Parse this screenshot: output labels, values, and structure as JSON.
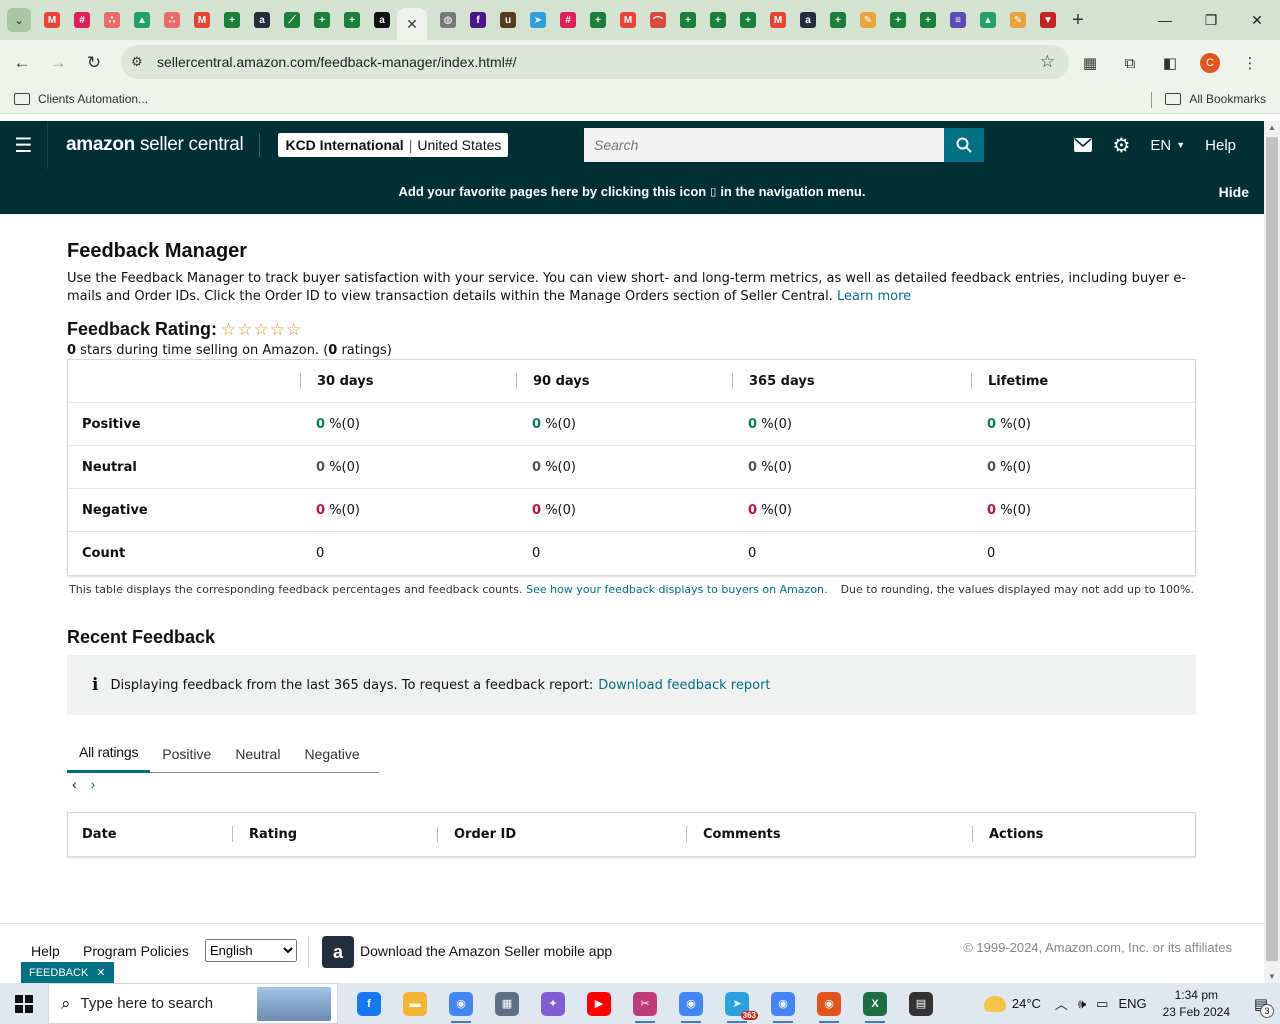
{
  "browser": {
    "tab_favicons": [
      {
        "name": "gmail-icon",
        "color": "#ea4335",
        "glyph": "M"
      },
      {
        "name": "slack-icon",
        "color": "#e01e5a",
        "glyph": "#"
      },
      {
        "name": "asana-icon",
        "color": "#f06a6a",
        "glyph": "∴"
      },
      {
        "name": "drive-icon",
        "color": "#1fa463",
        "glyph": "▲"
      },
      {
        "name": "asana-icon",
        "color": "#f06a6a",
        "glyph": "∴"
      },
      {
        "name": "gmail-icon",
        "color": "#ea4335",
        "glyph": "M"
      },
      {
        "name": "sheets-icon",
        "color": "#188038",
        "glyph": "+"
      },
      {
        "name": "amazon-icon",
        "color": "#232f3e",
        "glyph": "a"
      },
      {
        "name": "script-icon",
        "color": "#188038",
        "glyph": "⟋"
      },
      {
        "name": "sheets-icon",
        "color": "#188038",
        "glyph": "+"
      },
      {
        "name": "sheets-icon",
        "color": "#188038",
        "glyph": "+"
      },
      {
        "name": "amazon-icon",
        "color": "#111111",
        "glyph": "a"
      }
    ],
    "tab_favicons_after": [
      {
        "name": "globe-icon",
        "color": "#777777",
        "glyph": "◍"
      },
      {
        "name": "fedex-icon",
        "color": "#4d148c",
        "glyph": "f"
      },
      {
        "name": "ups-icon",
        "color": "#5a3b1c",
        "glyph": "u"
      },
      {
        "name": "telegram-icon",
        "color": "#2aa1de",
        "glyph": "➤"
      },
      {
        "name": "slack-icon",
        "color": "#e01e5a",
        "glyph": "#"
      },
      {
        "name": "sheets-icon",
        "color": "#188038",
        "glyph": "+"
      },
      {
        "name": "gmail-icon",
        "color": "#ea4335",
        "glyph": "M"
      },
      {
        "name": "rainbow-icon",
        "color": "#d84a3a",
        "glyph": "⌒"
      },
      {
        "name": "sheets-icon",
        "color": "#188038",
        "glyph": "+"
      },
      {
        "name": "sheets-icon",
        "color": "#188038",
        "glyph": "+"
      },
      {
        "name": "sheets-icon",
        "color": "#188038",
        "glyph": "+"
      },
      {
        "name": "gmail-icon",
        "color": "#ea4335",
        "glyph": "M"
      },
      {
        "name": "amazon-icon",
        "color": "#232f3e",
        "glyph": "a"
      },
      {
        "name": "sheets-icon",
        "color": "#188038",
        "glyph": "+"
      },
      {
        "name": "pen-icon",
        "color": "#e8a33d",
        "glyph": "✎"
      },
      {
        "name": "sheets-icon",
        "color": "#188038",
        "glyph": "+"
      },
      {
        "name": "sheets-icon",
        "color": "#188038",
        "glyph": "+"
      },
      {
        "name": "list-icon",
        "color": "#5b4bb7",
        "glyph": "≡"
      },
      {
        "name": "drive-icon",
        "color": "#1fa463",
        "glyph": "▲"
      },
      {
        "name": "pen-icon",
        "color": "#e8a33d",
        "glyph": "✎"
      },
      {
        "name": "flag-icon",
        "color": "#c5221f",
        "glyph": "▼"
      }
    ],
    "url": "sellercentral.amazon.com/feedback-manager/index.html#/",
    "bookmarks": {
      "left": "Clients Automation...",
      "right": "All Bookmarks"
    },
    "profile_initial": "C"
  },
  "header": {
    "logo_bold": "amazon",
    "logo_light": "seller central",
    "account_name": "KCD International",
    "account_region": "United States",
    "search_placeholder": "Search",
    "language": "EN",
    "help": "Help",
    "fav_message_pre": "Add your favorite pages here by clicking this icon",
    "fav_message_post": "in the navigation menu.",
    "hide": "Hide"
  },
  "page": {
    "title": "Feedback Manager",
    "intro": "Use the Feedback Manager to track buyer satisfaction with your service. You can view short- and long-term metrics, as well as detailed feedback entries, including buyer e-mails and Order IDs. Click the Order ID to view transaction details within the Manage Orders section of Seller Central.",
    "learn_more": "Learn more",
    "rating_label": "Feedback Rating:",
    "rating_stars": 0,
    "rating_stars_max": 5,
    "rating_sub_stars": "0",
    "rating_sub_mid": " stars during time selling on Amazon. (",
    "rating_sub_count": "0",
    "rating_sub_end": " ratings)"
  },
  "metrics": {
    "columns": [
      "30 days",
      "90 days",
      "365 days",
      "Lifetime"
    ],
    "rows": [
      {
        "label": "Positive",
        "cells": [
          {
            "n": "0",
            "p": "%(0)"
          },
          {
            "n": "0",
            "p": "%(0)"
          },
          {
            "n": "0",
            "p": "%(0)"
          },
          {
            "n": "0",
            "p": "%(0)"
          }
        ]
      },
      {
        "label": "Neutral",
        "cells": [
          {
            "n": "0",
            "p": "%(0)"
          },
          {
            "n": "0",
            "p": "%(0)"
          },
          {
            "n": "0",
            "p": "%(0)"
          },
          {
            "n": "0",
            "p": "%(0)"
          }
        ]
      },
      {
        "label": "Negative",
        "cells": [
          {
            "n": "0",
            "p": "%(0)"
          },
          {
            "n": "0",
            "p": "%(0)"
          },
          {
            "n": "0",
            "p": "%(0)"
          },
          {
            "n": "0",
            "p": "%(0)"
          }
        ]
      },
      {
        "label": "Count",
        "cells": [
          "0",
          "0",
          "0",
          "0"
        ]
      }
    ],
    "note_left": "This table displays the corresponding feedback percentages and feedback counts.",
    "note_link": "See how your feedback displays to buyers on Amazon.",
    "note_right": "Due to rounding, the values displayed may not add up to 100%.",
    "colors": {
      "positive": "#067d62",
      "negative": "#cc0c39"
    }
  },
  "recent": {
    "title": "Recent Feedback",
    "info_text": "Displaying feedback from the last 365 days. To request a feedback report:",
    "info_link": "Download feedback report",
    "tabs": [
      "All ratings",
      "Positive",
      "Neutral",
      "Negative"
    ],
    "table_columns": [
      "Date",
      "Rating",
      "Order ID",
      "Comments",
      "Actions"
    ]
  },
  "footer": {
    "help": "Help",
    "policies": "Program Policies",
    "language_selected": "English",
    "app_text": "Download the Amazon Seller mobile app",
    "copyright": "© 1999-2024, Amazon.com, Inc. or its affiliates",
    "badge": "FEEDBACK"
  },
  "taskbar": {
    "search_placeholder": "Type here to search",
    "apps": [
      {
        "name": "facebook-icon",
        "color": "#1877f2",
        "glyph": "f",
        "running": false
      },
      {
        "name": "file-explorer-icon",
        "color": "#f2b632",
        "glyph": "▬",
        "running": false
      },
      {
        "name": "chrome-icon",
        "color": "#4285f4",
        "glyph": "◉",
        "running": true
      },
      {
        "name": "calculator-icon",
        "color": "#5c6f86",
        "glyph": "▦",
        "running": false
      },
      {
        "name": "copilot-icon",
        "color": "#7f5cd6",
        "glyph": "✦",
        "running": false
      },
      {
        "name": "youtube-icon",
        "color": "#ff0000",
        "glyph": "▶",
        "running": false
      },
      {
        "name": "snipping-icon",
        "color": "#c0397b",
        "glyph": "✂",
        "running": true
      },
      {
        "name": "chrome-icon",
        "color": "#4285f4",
        "glyph": "◉",
        "running": true
      },
      {
        "name": "telegram-icon",
        "color": "#2aa1de",
        "glyph": "➤",
        "running": true,
        "badge": "363"
      },
      {
        "name": "chrome-icon",
        "color": "#4285f4",
        "glyph": "◉",
        "running": true
      },
      {
        "name": "chrome-icon",
        "color": "#e2541a",
        "glyph": "◉",
        "running": true
      },
      {
        "name": "excel-icon",
        "color": "#1d6f42",
        "glyph": "X",
        "running": true
      },
      {
        "name": "sticky-notes-icon",
        "color": "#333333",
        "glyph": "▤",
        "running": false
      }
    ],
    "temperature": "24°C",
    "language": "ENG",
    "time": "1:34 pm",
    "date": "23 Feb 2024",
    "notifications": "3"
  }
}
